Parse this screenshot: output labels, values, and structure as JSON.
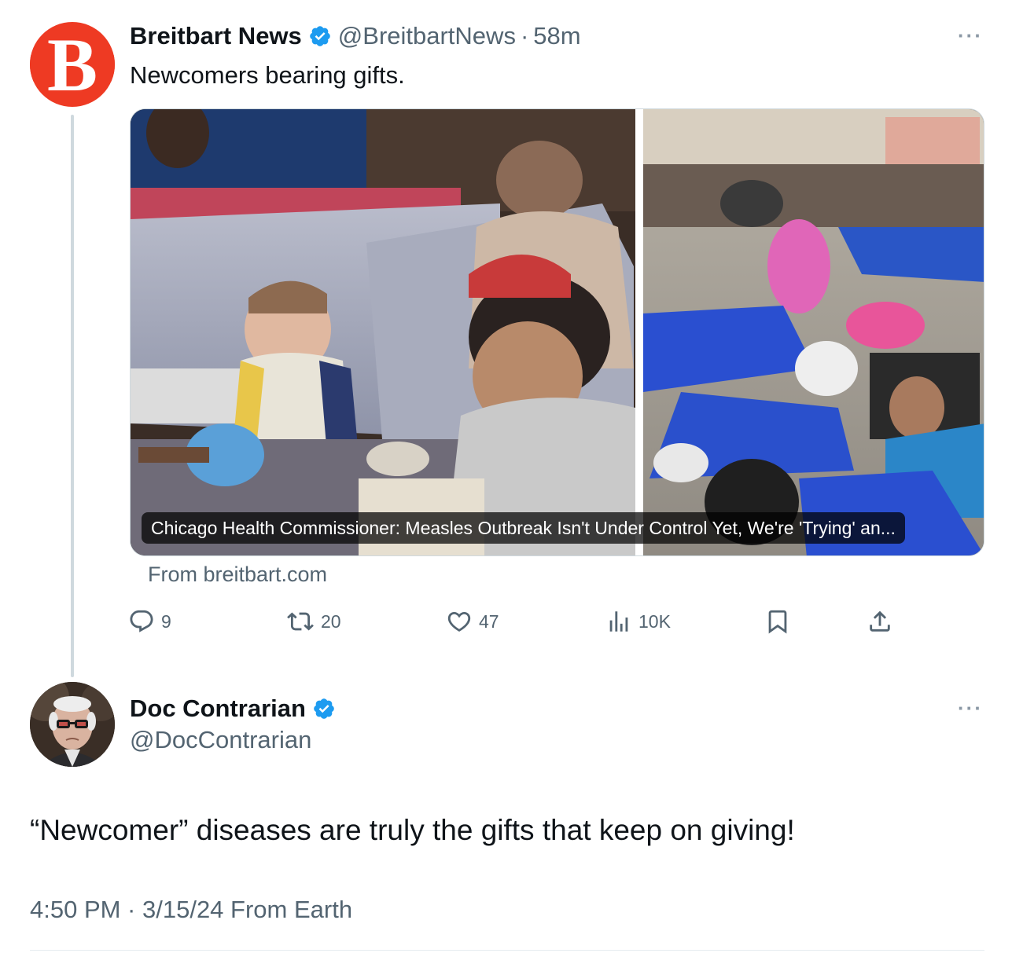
{
  "original_tweet": {
    "author_name": "Breitbart News",
    "avatar_letter": "B",
    "handle": "@BreitbartNews",
    "separator": "·",
    "time": "58m",
    "more": "···",
    "text": "Newcomers bearing gifts.",
    "card": {
      "title": "Chicago Health Commissioner: Measles Outbreak Isn't Under Control Yet, We're 'Trying' an...",
      "source": "From breitbart.com"
    },
    "actions": {
      "replies": "9",
      "reposts": "20",
      "likes": "47",
      "views": "10K"
    }
  },
  "reply_tweet": {
    "author_name": "Doc Contrarian",
    "handle": "@DocContrarian",
    "more": "···",
    "text": "“Newcomer” diseases are truly the gifts that keep on giving!",
    "meta": "4:50 PM · 3/15/24 From Earth"
  },
  "colors": {
    "verified_blue": "#1d9bf0",
    "breitbart_orange": "#ee3a23",
    "secondary_text": "#536471",
    "primary_text": "#0f1419"
  },
  "icons": [
    "reply-icon",
    "repost-icon",
    "like-icon",
    "views-icon",
    "bookmark-icon",
    "share-icon",
    "verified-icon",
    "more-icon"
  ]
}
